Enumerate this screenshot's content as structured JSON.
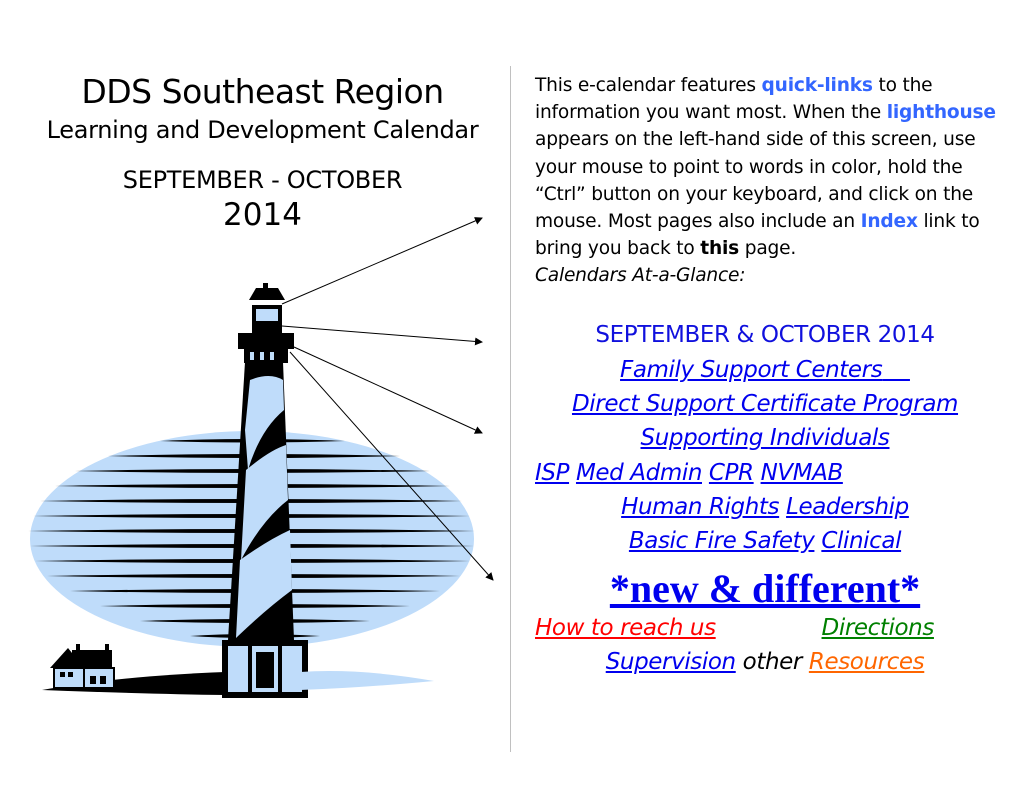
{
  "header": {
    "title": "DDS Southeast Region",
    "subtitle": "Learning and Development Calendar",
    "period": "SEPTEMBER - OCTOBER",
    "year": "2014"
  },
  "illustration": {
    "name": "lighthouse",
    "colors": {
      "water": "#bfdcfa",
      "ink": "#000000"
    }
  },
  "intro": {
    "p1": "This e-calendar features ",
    "quick_links": "quick-links",
    "p2": " to the information you want most. When the ",
    "lighthouse": "lighthouse",
    "p3": " appears on the left-hand side of this screen, use your mouse to point to words in color, hold the “Ctrl” button on your keyboard, and click on the mouse. Most pages also include an ",
    "index": "Index",
    "p4": " link to bring you back to ",
    "this": "this",
    "p5": " page.",
    "calendars_label": "Calendars At-a-Glance:",
    "highlight_color": "#3366ff"
  },
  "links": {
    "sep_oct": "SEPTEMBER & OCTOBER 2014",
    "family_support": "Family Support Centers",
    "direct_support": "Direct Support Certificate Program",
    "supporting_individuals": "Supporting Individuals",
    "isp": "ISP",
    "med_admin": "Med Admin",
    "cpr": "CPR",
    "nvmab": "NVMAB",
    "human_rights": "Human Rights",
    "leadership": "Leadership",
    "basic_fire_safety": "Basic Fire Safety",
    "clinical": "Clinical",
    "new_different": "*new & different*",
    "how_to_reach": "How to reach us",
    "directions": "Directions",
    "supervision": "Supervision",
    "other": "other",
    "resources": "Resources"
  },
  "colors": {
    "link_blue": "#0000ee",
    "red": "#ff0000",
    "green": "#008000",
    "orange": "#ff6600"
  }
}
